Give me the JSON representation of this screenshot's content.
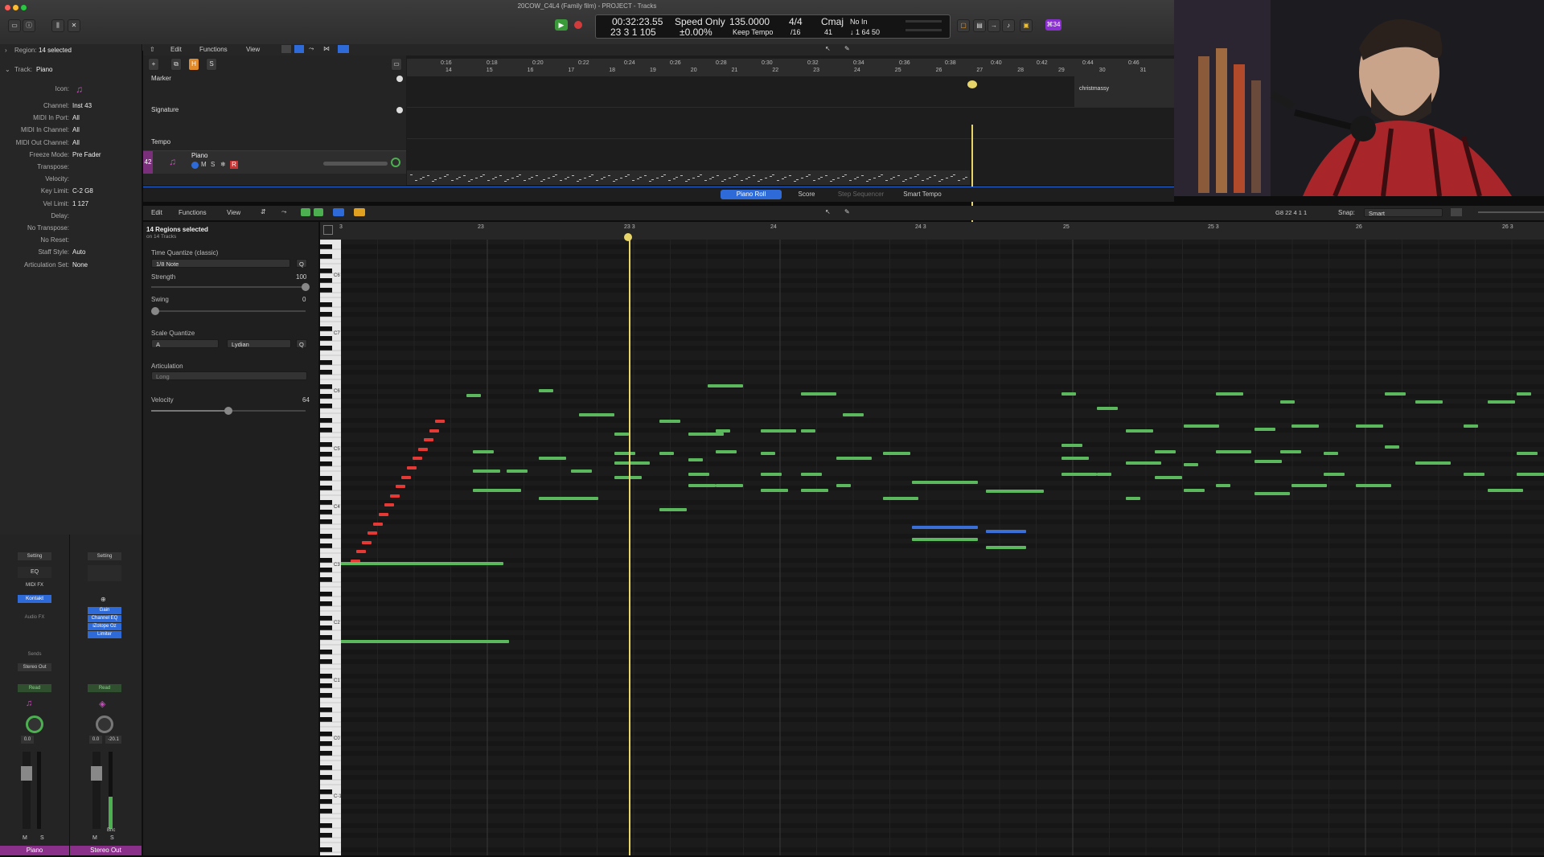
{
  "window": {
    "title": "20COW_C4L4 (Family film) - PROJECT - Tracks",
    "accent": "#2f6bd8"
  },
  "lcd": {
    "time": "00:32:23.55",
    "bars": "23  3  1  105",
    "mode": "Speed Only",
    "pct": "±0.00%",
    "tempo": "135.0000",
    "tempo_label": "Keep Tempo",
    "sig_top": "4/4",
    "sig_bottom": "/16",
    "key": "Cmaj",
    "key_num": "41",
    "in_label": "No In",
    "in_value": "↓ 1  64  50"
  },
  "badge": "⌘34",
  "inspector": {
    "region_label": "Region:",
    "region_value": "14 selected",
    "track_label": "Track:",
    "track_value": "Piano",
    "icon_label": "Icon:",
    "rows": [
      {
        "k": "Channel:",
        "v": "Inst 43"
      },
      {
        "k": "MIDI In Port:",
        "v": "All"
      },
      {
        "k": "MIDI In Channel:",
        "v": "All"
      },
      {
        "k": "MIDI Out Channel:",
        "v": "All"
      },
      {
        "k": "Freeze Mode:",
        "v": "Pre Fader"
      },
      {
        "k": "Transpose:",
        "v": ""
      },
      {
        "k": "Velocity:",
        "v": ""
      },
      {
        "k": "Key Limit:",
        "v": "C-2  G8"
      },
      {
        "k": "Vel Limit:",
        "v": "1  127"
      },
      {
        "k": "Delay:",
        "v": ""
      },
      {
        "k": "No Transpose:",
        "v": ""
      },
      {
        "k": "No Reset:",
        "v": ""
      },
      {
        "k": "Staff Style:",
        "v": "Auto"
      },
      {
        "k": "Articulation Set:",
        "v": "None"
      }
    ]
  },
  "tracks": {
    "menu": [
      "Edit",
      "Functions",
      "View"
    ],
    "lanes": [
      "Marker",
      "Signature",
      "Tempo"
    ],
    "marker_text": "christmassy",
    "track_num": "42",
    "track_name": "Piano",
    "ruler_bars": [
      "14",
      "15",
      "16",
      "17",
      "18",
      "19",
      "20",
      "21",
      "22",
      "23",
      "24",
      "25",
      "26",
      "27",
      "28",
      "29",
      "30",
      "31"
    ],
    "ruler_times": [
      "0:16",
      "0:18",
      "0:20",
      "0:22",
      "0:24",
      "0:26",
      "0:28",
      "0:30",
      "0:32",
      "0:34",
      "0:36",
      "0:38",
      "0:40",
      "0:42",
      "0:44",
      "0:46"
    ]
  },
  "piano_roll_tabs": [
    "Piano Roll",
    "Score",
    "Step Sequencer",
    "Smart Tempo"
  ],
  "pr_toolbar": {
    "menu": [
      "Edit",
      "Functions",
      "View"
    ],
    "position": "G8  22 4 1 1",
    "snap_label": "Snap:",
    "snap_value": "Smart"
  },
  "quantize": {
    "title": "14 Regions selected",
    "subtitle": "on 14 Tracks",
    "time_quantize_label": "Time Quantize (classic)",
    "time_quantize_value": "1/8 Note",
    "q_button": "Q",
    "strength_label": "Strength",
    "strength_value": "100",
    "swing_label": "Swing",
    "swing_value": "0",
    "scale_quantize_label": "Scale Quantize",
    "scale_root": "A",
    "scale_mode": "Lydian",
    "articulation_label": "Articulation",
    "articulation_value": "Long",
    "velocity_label": "Velocity",
    "velocity_value": "64",
    "velocity_level": 0.5
  },
  "pr_ruler": [
    "3",
    "23",
    "23 3",
    "24",
    "24 3",
    "25",
    "25 3",
    "26",
    "26 3"
  ],
  "octaves": [
    "C6",
    "C7",
    "C6",
    "C5",
    "C4",
    "C3",
    "C2",
    "C1",
    "C0",
    "C-1"
  ],
  "mixer": {
    "strip1": {
      "setting": "Setting",
      "eq": "EQ",
      "midi_fx": "MIDI FX",
      "instrument": "Kontakt",
      "audio_fx": "Audio FX",
      "sends": "Sends",
      "output": "Stereo Out",
      "read": "Read",
      "vol": "0.0",
      "name": "Piano"
    },
    "strip2": {
      "setting": "Setting",
      "plugins": [
        "Gain",
        "Channel EQ",
        "iZotope Oz",
        "Limiter"
      ],
      "read": "Read",
      "vol": "0.0",
      "peak": "-20.1",
      "name": "Stereo Out",
      "bnc": "Bnc"
    }
  }
}
